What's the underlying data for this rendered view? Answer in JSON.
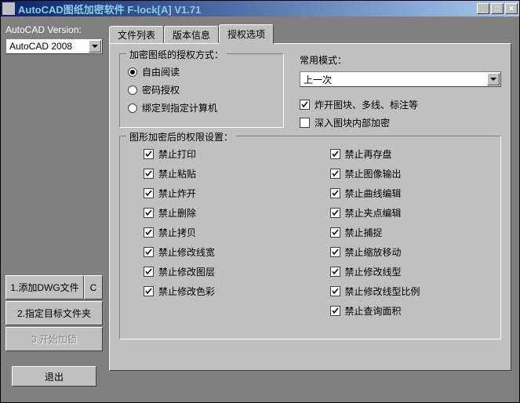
{
  "title": "AutoCAD图纸加密软件 F-lock[A] V1.71",
  "left": {
    "version_label": "AutoCAD Version:",
    "version_value": "AutoCAD 2008",
    "btn_add": "1.添加DWG文件",
    "btn_c": "C",
    "btn_folder": "2.指定目标文件夹",
    "btn_start": "3.开始加锁",
    "btn_exit": "退出"
  },
  "tabs": [
    "文件列表",
    "版本信息",
    "授权选项"
  ],
  "auth": {
    "group_title": "加密图纸的授权方式：",
    "options": [
      "自由阅读",
      "密码授权",
      "绑定到指定计算机"
    ],
    "selected": 0
  },
  "mode": {
    "label": "常用模式：",
    "value": "上一次",
    "cb_explode": "炸开图块、多线、标注等",
    "cb_deep": "深入图块内部加密"
  },
  "perms": {
    "group_title": "图形加密后的权限设置：",
    "left": [
      "禁止打印",
      "禁止粘贴",
      "禁止炸开",
      "禁止删除",
      "禁止拷贝",
      "禁止修改线宽",
      "禁止修改图层",
      "禁止修改色彩"
    ],
    "right": [
      "禁止再存盘",
      "禁止图像输出",
      "禁止曲线编辑",
      "禁止夹点编辑",
      "禁止捕捉",
      "禁止缩放移动",
      "禁止修改线型",
      "禁止修改线型比例",
      "禁止查询面积"
    ]
  }
}
